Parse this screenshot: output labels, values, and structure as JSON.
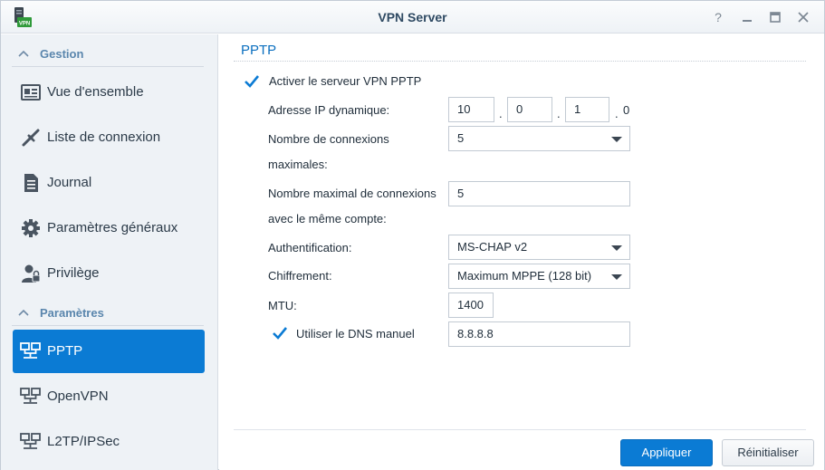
{
  "window": {
    "title": "VPN Server",
    "app_icon_badge": "VPN",
    "controls": [
      "help-icon",
      "minimize-icon",
      "maximize-icon",
      "close-icon"
    ]
  },
  "sidebar": {
    "groups": [
      {
        "label": "Gestion",
        "items": [
          {
            "label": "Vue d'ensemble",
            "icon": "overview-icon"
          },
          {
            "label": "Liste de connexion",
            "icon": "connection-list-icon"
          },
          {
            "label": "Journal",
            "icon": "log-icon"
          },
          {
            "label": "Paramètres généraux",
            "icon": "gear-icon"
          },
          {
            "label": "Privilège",
            "icon": "user-lock-icon"
          }
        ]
      },
      {
        "label": "Paramètres",
        "items": [
          {
            "label": "PPTP",
            "icon": "network-icon",
            "active": true
          },
          {
            "label": "OpenVPN",
            "icon": "network-icon"
          },
          {
            "label": "L2TP/IPSec",
            "icon": "network-icon"
          }
        ]
      }
    ]
  },
  "main": {
    "section_title": "PPTP",
    "enable_pptp": {
      "label": "Activer le serveur VPN PPTP",
      "checked": true
    },
    "dynamic_ip": {
      "label": "Adresse IP dynamique:",
      "octets": [
        "10",
        "0",
        "1"
      ],
      "last_octet": "0",
      "separator": "."
    },
    "max_connections": {
      "label_line1": "Nombre de connexions",
      "label_line2": "maximales:",
      "value": "5"
    },
    "max_same_account": {
      "label_line1": "Nombre maximal de connexions",
      "label_line2": "avec le même compte:",
      "value": "5"
    },
    "authentication": {
      "label": "Authentification:",
      "value": "MS-CHAP v2"
    },
    "encryption": {
      "label": "Chiffrement:",
      "value": "Maximum MPPE (128 bit)"
    },
    "mtu": {
      "label": "MTU:",
      "value": "1400"
    },
    "manual_dns": {
      "label": "Utiliser le DNS manuel",
      "checked": true,
      "value": "8.8.8.8"
    }
  },
  "footer": {
    "apply_label": "Appliquer",
    "reset_label": "Réinitialiser"
  },
  "colors": {
    "accent": "#0b7bd4",
    "sidebar_bg": "#eef2f6",
    "group_header": "#5a86ad",
    "section_title": "#0b6fbf"
  }
}
